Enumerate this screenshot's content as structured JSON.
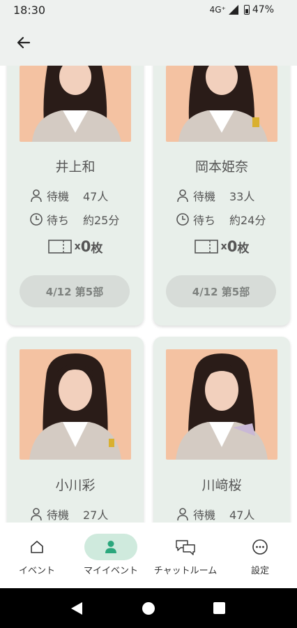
{
  "status": {
    "time": "18:30",
    "network": "4G⁺",
    "battery": "47%"
  },
  "app_bar": {
    "back_icon": "arrow-left-icon"
  },
  "cards": [
    {
      "name": "井上和",
      "waiting_label": "待機",
      "waiting_value": "47人",
      "wait_time_label": "待ち",
      "wait_time_value": "約25分",
      "ticket_x": "x",
      "ticket_count": "0",
      "ticket_unit": "枚",
      "session": "4/12 第5部"
    },
    {
      "name": "岡本姫奈",
      "waiting_label": "待機",
      "waiting_value": "33人",
      "wait_time_label": "待ち",
      "wait_time_value": "約24分",
      "ticket_x": "x",
      "ticket_count": "0",
      "ticket_unit": "枚",
      "session": "4/12 第5部"
    },
    {
      "name": "小川彩",
      "waiting_label": "待機",
      "waiting_value": "27人"
    },
    {
      "name": "川﨑桜",
      "waiting_label": "待機",
      "waiting_value": "47人"
    }
  ],
  "nav": [
    {
      "label": "イベント",
      "icon": "home-icon",
      "active": false
    },
    {
      "label": "マイイベント",
      "icon": "person-icon",
      "active": true
    },
    {
      "label": "チャットルーム",
      "icon": "chat-icon",
      "active": false
    },
    {
      "label": "設定",
      "icon": "more-icon",
      "active": false
    }
  ],
  "colors": {
    "card_bg": "#e8efea",
    "active_nav_pill": "#cfeadd",
    "accent": "#3bbf8f",
    "session_button_bg": "#d7dcd8"
  }
}
